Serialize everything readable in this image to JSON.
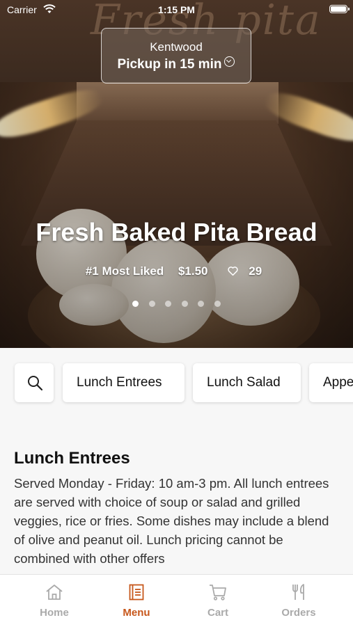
{
  "status_bar": {
    "carrier": "Carrier",
    "time": "1:15 PM"
  },
  "brand_logo_text": "Fresh pita",
  "location": {
    "name": "Kentwood",
    "pickup": "Pickup in 15 min"
  },
  "hero": {
    "title": "Fresh Baked Pita Bread",
    "badge": "#1 Most Liked",
    "price": "$1.50",
    "likes": "29",
    "slides_total": 6,
    "active_slide": 1
  },
  "categories": [
    "Lunch Entrees",
    "Lunch Salad",
    "Appe"
  ],
  "section": {
    "title": "Lunch Entrees",
    "description": "Served Monday - Friday: 10 am-3 pm. All lunch entrees are served with choice of soup or salad and grilled veggies, rice or fries. Some dishes may include a blend of olive and peanut oil. Lunch pricing cannot be combined with other offers"
  },
  "tabbar": {
    "items": [
      {
        "label": "Home",
        "icon": "home-icon"
      },
      {
        "label": "Menu",
        "icon": "menu-book-icon"
      },
      {
        "label": "Cart",
        "icon": "cart-icon"
      },
      {
        "label": "Orders",
        "icon": "utensils-icon"
      }
    ],
    "active": "Menu"
  },
  "colors": {
    "accent": "#c7571b",
    "inactive": "#aaaaaa",
    "header": "#4a3426"
  }
}
